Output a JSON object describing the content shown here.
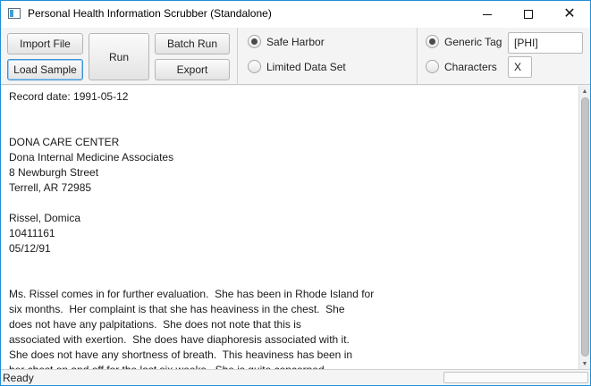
{
  "window": {
    "title": "Personal Health Information Scrubber (Standalone)"
  },
  "toolbar": {
    "import_label": "Import File",
    "load_sample_label": "Load Sample",
    "run_label": "Run",
    "batch_run_label": "Batch Run",
    "export_label": "Export"
  },
  "method": {
    "safe_harbor_label": "Safe Harbor",
    "limited_data_set_label": "Limited Data Set",
    "selected": "Safe Harbor"
  },
  "replacement": {
    "generic_tag_label": "Generic Tag",
    "characters_label": "Characters",
    "selected": "Generic Tag",
    "generic_tag_value": "[PHI]",
    "character_value": "X"
  },
  "document": {
    "text": "Record date: 1991-05-12\n\n\nDONA CARE CENTER\nDona Internal Medicine Associates\n8 Newburgh Street\nTerrell, AR 72985\n\nRissel, Domica\n10411161\n05/12/91\n\n\nMs. Rissel comes in for further evaluation.  She has been in Rhode Island for\nsix months.  Her complaint is that she has heaviness in the chest.  She\ndoes not have any palpitations.  She does not note that this is\nassociated with exertion.  She does have diaphoresis associated with it.\nShe does not have any shortness of breath.  This heaviness has been in\nher chest on and off for the last six weeks.  She is quite concerned"
  },
  "status": {
    "text": "Ready",
    "progress": 0
  },
  "colors": {
    "accent": "#3a94d6",
    "window_border": "#1f8fd8"
  },
  "icons": {
    "app": "app-window-icon",
    "minimize": "minimize-icon",
    "maximize": "maximize-icon",
    "close": "close-icon",
    "scroll_up": "scroll-up-arrow-icon",
    "scroll_down": "scroll-down-arrow-icon"
  }
}
